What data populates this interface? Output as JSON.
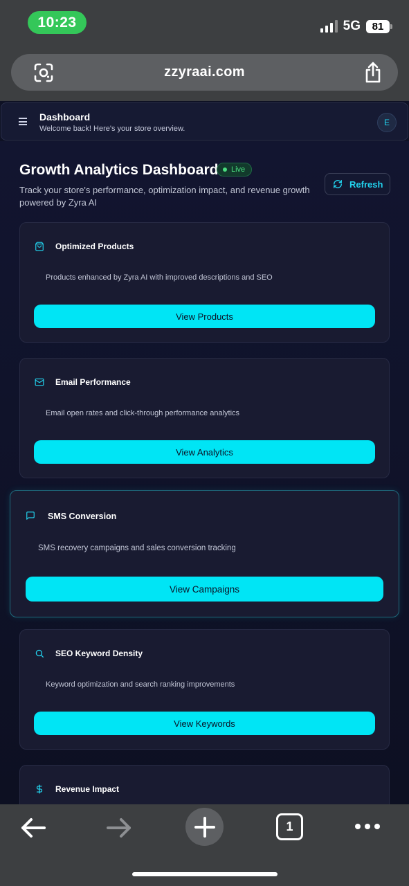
{
  "status_bar": {
    "time": "10:23",
    "network": "5G",
    "battery": "81"
  },
  "browser": {
    "url": "zzyraai.com",
    "tab_count": "1"
  },
  "app_header": {
    "title": "Dashboard",
    "subtitle": "Welcome back! Here's your store overview.",
    "avatar_letter": "E"
  },
  "page": {
    "title": "Growth Analytics Dashboard",
    "badge": "Live",
    "description": "Track your store's performance, optimization impact, and revenue growth powered by Zyra AI",
    "refresh_label": "Refresh"
  },
  "cards": [
    {
      "icon": "shopping-bag-icon",
      "title": "Optimized Products",
      "description": "Products enhanced by Zyra AI with improved descriptions and SEO",
      "button": "View Products"
    },
    {
      "icon": "mail-icon",
      "title": "Email Performance",
      "description": "Email open rates and click-through performance analytics",
      "button": "View Analytics"
    },
    {
      "icon": "message-square-icon",
      "title": "SMS Conversion",
      "description": "SMS recovery campaigns and sales conversion tracking",
      "button": "View Campaigns"
    },
    {
      "icon": "search-icon",
      "title": "SEO Keyword Density",
      "description": "Keyword optimization and search ranking improvements",
      "button": "View Keywords"
    },
    {
      "icon": "dollar-sign-icon",
      "title": "Revenue Impact"
    }
  ],
  "colors": {
    "accent": "#00e5f5",
    "live": "#4ade80",
    "background": "#0e1124",
    "card": "#191b31"
  }
}
